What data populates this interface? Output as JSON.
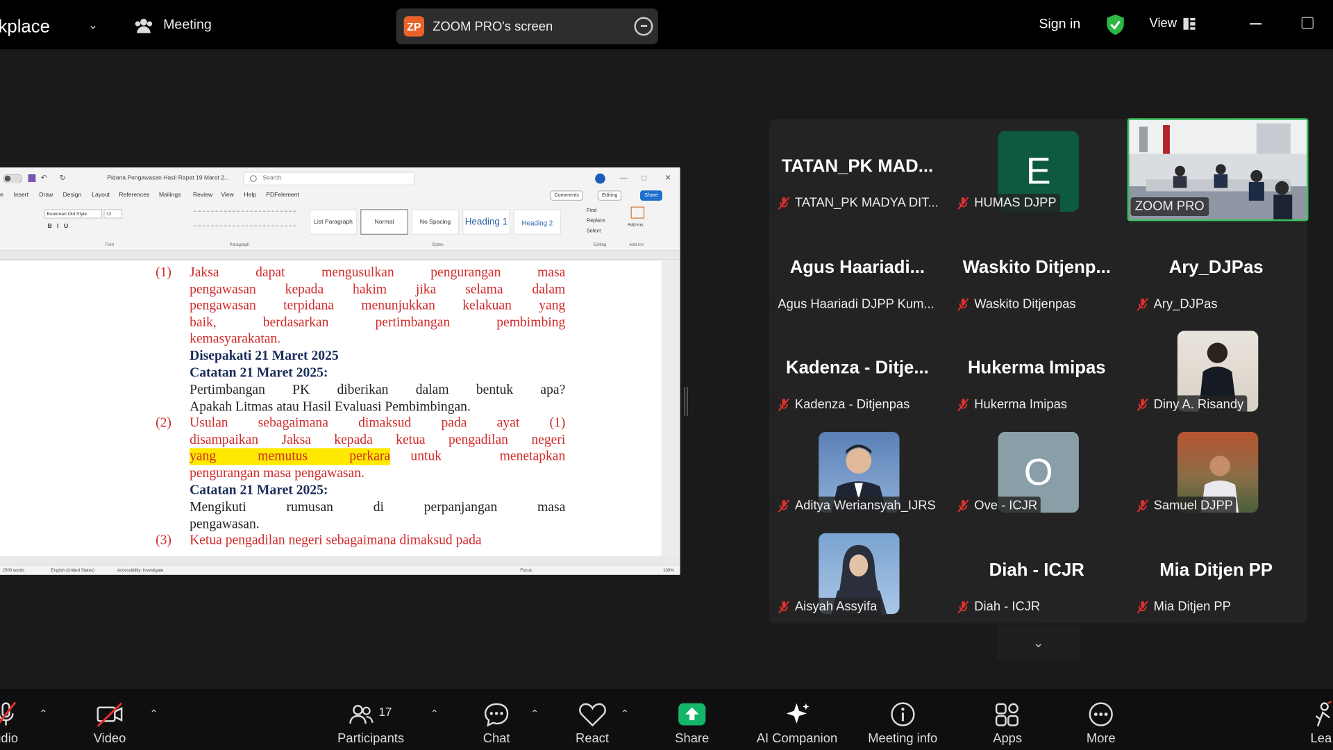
{
  "topbar": {
    "app_name": "kplace",
    "meeting_label": "Meeting",
    "share_badge": "ZP",
    "share_title": "ZOOM PRO's screen",
    "signin": "Sign in",
    "view": "View"
  },
  "word": {
    "doc_title": "Pidana Pengawasan Hasil Rapat 19 Maret 2...",
    "search_placeholder": "Search",
    "tabs": [
      "e",
      "Insert",
      "Draw",
      "Design",
      "Layout",
      "References",
      "Mailings",
      "Review",
      "View",
      "Help",
      "PDFelement"
    ],
    "comments": "Comments",
    "editing": "Editing",
    "share": "Share",
    "font_name": "Bookman Old Style",
    "font_size": "12",
    "styles": [
      "List Paragraph",
      "Normal",
      "No Spacing",
      "Heading 1",
      "Heading 2"
    ],
    "editing_items": [
      "Find",
      "Replace",
      "Select"
    ],
    "addins": "Add-ins",
    "group_labels": [
      "Font",
      "Paragraph",
      "Styles",
      "Editing",
      "Add-ins"
    ],
    "status": {
      "words": "2500 words",
      "lang": "English (United States)",
      "access": "Accessibility: Investigate",
      "focus": "Focus",
      "zoom": "100%"
    }
  },
  "document": {
    "p1_num": "(1)",
    "p1_lines": [
      "Jaksa dapat mengusulkan pengurangan masa",
      "pengawasan kepada hakim jika selama dalam",
      "pengawasan terpidana menunjukkan kelakuan yang",
      "baik, berdasarkan pertimbangan pembimbing",
      "kemasyarakatan."
    ],
    "agreed": "Disepakati 21 Maret 2025",
    "note1": "Catatan 21 Maret 2025:",
    "note1_lines": [
      "Pertimbangan PK diberikan dalam bentuk apa?",
      "Apakah Litmas atau Hasil Evaluasi Pembimbingan."
    ],
    "p2_num": "(2)",
    "p2_lines": [
      "Usulan sebagaimana dimaksud pada ayat (1)",
      "disampaikan Jaksa kepada ketua pengadilan negeri"
    ],
    "p2_highlight": "yang memutus perkara",
    "p2_after_highlight": "untuk menetapkan",
    "p2_last": "pengurangan masa pengawasan.",
    "note2": "Catatan 21 Maret 2025:",
    "note2_lines": [
      "Mengikuti rumusan di perpanjangan masa",
      "pengawasan."
    ],
    "p3_num": "(3)",
    "p3_line": "Ketua pengadilan negeri sebagaimana dimaksud pada"
  },
  "participants": [
    {
      "big": "TATAN_PK  MAD...",
      "label": "TATAN_PK MADYA DIT..."
    },
    {
      "big": "",
      "letter": "E",
      "label": "HUMAS DJPP"
    },
    {
      "big": "",
      "label": "ZOOM PRO"
    },
    {
      "big": "Agus  Haariadi...",
      "label": "Agus Haariadi DJPP Kum..."
    },
    {
      "big": "Waskito  Ditjenp...",
      "label": "Waskito Ditjenpas"
    },
    {
      "big": "Ary_DJPas",
      "label": "Ary_DJPas"
    },
    {
      "big": "Kadenza  -  Ditje...",
      "label": "Kadenza - Ditjenpas"
    },
    {
      "big": "Hukerma  Imipas",
      "label": "Hukerma Imipas"
    },
    {
      "big": "",
      "label": "Diny A. Risandy"
    },
    {
      "big": "",
      "label": "Aditya Weriansyah_IJRS"
    },
    {
      "big": "",
      "letter": "O",
      "label": "Ove - ICJR"
    },
    {
      "big": "",
      "label": "Samuel DJPP"
    },
    {
      "big": "",
      "label": "Aisyah Assyifa"
    },
    {
      "big": "Diah  -  ICJR",
      "label": "Diah - ICJR"
    },
    {
      "big": "Mia  Ditjen  PP",
      "label": "Mia Ditjen PP"
    }
  ],
  "toolbar": {
    "audio": "udio",
    "video": "Video",
    "participants": "Participants",
    "participants_count": "17",
    "chat": "Chat",
    "react": "React",
    "share": "Share",
    "ai": "AI Companion",
    "info": "Meeting info",
    "apps": "Apps",
    "more": "More",
    "leave": "Lea"
  },
  "colors": {
    "share_green": "#13b66a",
    "active_border": "#35c45a",
    "muted_red": "#e0302e",
    "doc_red": "#d12a2a",
    "doc_navy": "#1a2d5a",
    "highlight": "#ffe900",
    "zp_orange": "#e8622a"
  }
}
